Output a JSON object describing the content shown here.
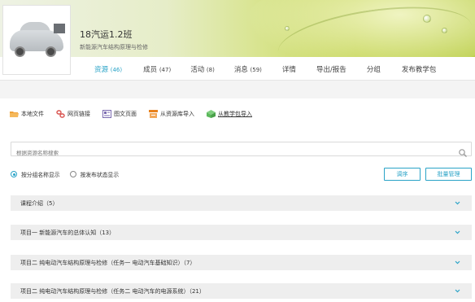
{
  "course": {
    "title": "18汽运1.2班",
    "subtitle": "新能源汽车结构原理与检修"
  },
  "tabs": [
    {
      "label": "资源",
      "count": "(46)",
      "active": true
    },
    {
      "label": "成员",
      "count": "(47)",
      "active": false
    },
    {
      "label": "活动",
      "count": "(8)",
      "active": false
    },
    {
      "label": "消息",
      "count": "(59)",
      "active": false
    },
    {
      "label": "详情",
      "count": "",
      "active": false
    },
    {
      "label": "导出/报告",
      "count": "",
      "active": false
    },
    {
      "label": "分组",
      "count": "",
      "active": false
    },
    {
      "label": "发布教学包",
      "count": "",
      "active": false
    }
  ],
  "toolbar": {
    "local_file": "本地文件",
    "web_link": "网页链接",
    "rich_page": "图文页面",
    "from_library": "从资源库导入",
    "from_package": "从教学包导入"
  },
  "search": {
    "placeholder": "根据资源名称搜索"
  },
  "display_options": {
    "by_group": "按分组名称显示",
    "by_status": "按发布状态显示"
  },
  "buttons": {
    "sort": "调序",
    "batch": "批量管理"
  },
  "groups": [
    "课程介绍（5）",
    "项目一  新能源汽车的总体认知（13）",
    "项目二  纯电动汽车结构原理与检修（任务一  电动汽车基础知识）（7）",
    "项目二  纯电动汽车结构原理与检修（任务二  电动汽车的电源系统）（21）"
  ],
  "colors": {
    "accent": "#2aa3c7",
    "group_bg": "#eeeeee",
    "folder_orange": "#f0a23a",
    "link_red": "#d9534f",
    "page_purple": "#7b6bb0",
    "import_orange": "#e8821e",
    "package_green": "#5cb85c"
  },
  "icons": {
    "local_file": "folder-icon",
    "web_link": "link-icon",
    "rich_page": "page-icon",
    "from_library": "library-import-icon",
    "from_package": "package-import-icon",
    "search": "search-icon",
    "group_toggle": "chevron-down-icon"
  }
}
